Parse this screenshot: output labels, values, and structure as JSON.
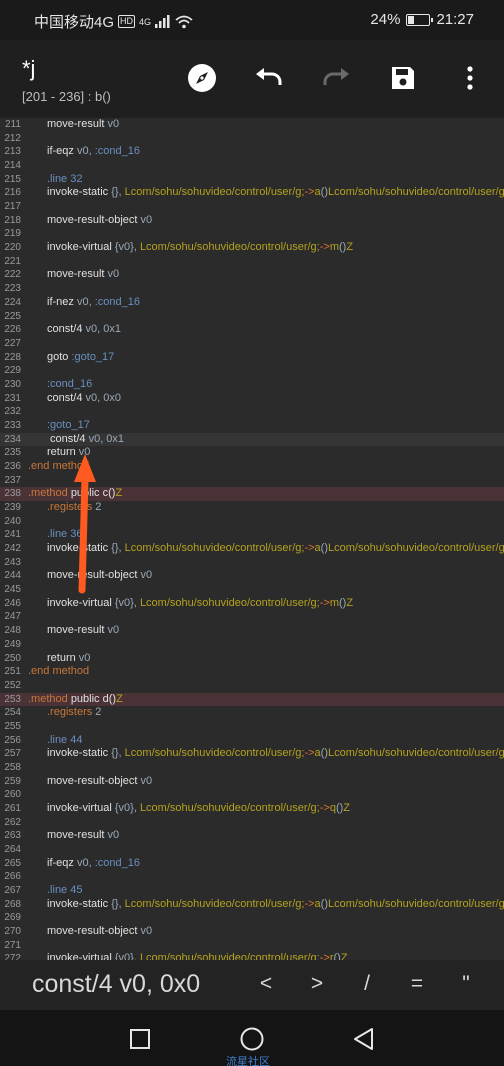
{
  "status": {
    "carrier": "中国移动4G",
    "hd": "HD",
    "signal_tag": "4G",
    "battery_percent": "24%",
    "battery_level": 0.24,
    "time": "21:27"
  },
  "toolbar": {
    "title": "*j",
    "subtitle": "[201 - 236] : b()",
    "icons": [
      "compass-icon",
      "undo-icon",
      "redo-icon",
      "save-icon",
      "more-vert-icon"
    ]
  },
  "code_lines": [
    {
      "n": "211",
      "segs": [
        [
          "kw",
          "move-result "
        ],
        [
          "reg",
          "v0"
        ]
      ]
    },
    {
      "n": "212",
      "segs": []
    },
    {
      "n": "213",
      "segs": [
        [
          "kw",
          "if-eqz "
        ],
        [
          "reg",
          "v0, "
        ],
        [
          "lbl",
          ":cond_16"
        ]
      ]
    },
    {
      "n": "214",
      "segs": []
    },
    {
      "n": "215",
      "segs": [
        [
          "lbl",
          ".line "
        ],
        [
          "lbl",
          "32"
        ]
      ]
    },
    {
      "n": "216",
      "segs": [
        [
          "kw",
          "invoke-static "
        ],
        [
          "reg",
          "{}, "
        ],
        [
          "cls",
          "Lcom/sohu/sohuvideo/control/user/g;"
        ],
        [
          "arrow",
          "->"
        ],
        [
          "cls",
          "a"
        ],
        [
          "reg",
          "()"
        ],
        [
          "cls",
          "Lcom/sohu/sohuvideo/control/user/g;"
        ]
      ]
    },
    {
      "n": "217",
      "segs": []
    },
    {
      "n": "218",
      "segs": [
        [
          "kw",
          "move-result-object "
        ],
        [
          "reg",
          "v0"
        ]
      ]
    },
    {
      "n": "219",
      "segs": []
    },
    {
      "n": "220",
      "segs": [
        [
          "kw",
          "invoke-virtual "
        ],
        [
          "reg",
          "{v0}, "
        ],
        [
          "cls",
          "Lcom/sohu/sohuvideo/control/user/g;"
        ],
        [
          "arrow",
          "->"
        ],
        [
          "cls",
          "m"
        ],
        [
          "reg",
          "()"
        ],
        [
          "cls",
          "Z"
        ]
      ]
    },
    {
      "n": "221",
      "segs": []
    },
    {
      "n": "222",
      "segs": [
        [
          "kw",
          "move-result "
        ],
        [
          "reg",
          "v0"
        ]
      ]
    },
    {
      "n": "223",
      "segs": []
    },
    {
      "n": "224",
      "segs": [
        [
          "kw",
          "if-nez "
        ],
        [
          "reg",
          "v0, "
        ],
        [
          "lbl",
          ":cond_16"
        ]
      ]
    },
    {
      "n": "225",
      "segs": []
    },
    {
      "n": "226",
      "segs": [
        [
          "kw",
          "const/4 "
        ],
        [
          "reg",
          "v0, 0x1"
        ]
      ]
    },
    {
      "n": "227",
      "segs": []
    },
    {
      "n": "228",
      "segs": [
        [
          "kw",
          "goto "
        ],
        [
          "lbl",
          ":goto_17"
        ]
      ]
    },
    {
      "n": "229",
      "segs": []
    },
    {
      "n": "230",
      "segs": [
        [
          "lbl",
          ":cond_16"
        ]
      ]
    },
    {
      "n": "231",
      "segs": [
        [
          "kw",
          "const/4 "
        ],
        [
          "reg",
          "v0, 0x0"
        ]
      ]
    },
    {
      "n": "232",
      "segs": []
    },
    {
      "n": "233",
      "segs": [
        [
          "lbl",
          ":goto_17"
        ]
      ]
    },
    {
      "n": "234",
      "segs": [
        [
          "kw",
          " const/4 "
        ],
        [
          "reg",
          "v0, 0x1"
        ]
      ],
      "hl": "current"
    },
    {
      "n": "235",
      "segs": [
        [
          "kw",
          "return "
        ],
        [
          "reg",
          "v0"
        ]
      ]
    },
    {
      "n": "236",
      "segs": [
        [
          "dir",
          ".end method"
        ]
      ],
      "indent": 0
    },
    {
      "n": "237",
      "segs": []
    },
    {
      "n": "238",
      "segs": [
        [
          "dir",
          ".method "
        ],
        [
          "kw",
          "public c()"
        ],
        [
          "cls",
          "Z"
        ]
      ],
      "indent": 0,
      "hl": "method"
    },
    {
      "n": "239",
      "segs": [
        [
          "dir",
          ".registers "
        ],
        [
          "reg",
          "2"
        ]
      ]
    },
    {
      "n": "240",
      "segs": []
    },
    {
      "n": "241",
      "segs": [
        [
          "lbl",
          ".line "
        ],
        [
          "lbl",
          "36"
        ]
      ]
    },
    {
      "n": "242",
      "segs": [
        [
          "kw",
          "invoke-static "
        ],
        [
          "reg",
          "{}, "
        ],
        [
          "cls",
          "Lcom/sohu/sohuvideo/control/user/g;"
        ],
        [
          "arrow",
          "->"
        ],
        [
          "cls",
          "a"
        ],
        [
          "reg",
          "()"
        ],
        [
          "cls",
          "Lcom/sohu/sohuvideo/control/user/g;"
        ]
      ]
    },
    {
      "n": "243",
      "segs": []
    },
    {
      "n": "244",
      "segs": [
        [
          "kw",
          "move-result-object "
        ],
        [
          "reg",
          "v0"
        ]
      ]
    },
    {
      "n": "245",
      "segs": []
    },
    {
      "n": "246",
      "segs": [
        [
          "kw",
          "invoke-virtual "
        ],
        [
          "reg",
          "{v0}, "
        ],
        [
          "cls",
          "Lcom/sohu/sohuvideo/control/user/g;"
        ],
        [
          "arrow",
          "->"
        ],
        [
          "cls",
          "m"
        ],
        [
          "reg",
          "()"
        ],
        [
          "cls",
          "Z"
        ]
      ]
    },
    {
      "n": "247",
      "segs": []
    },
    {
      "n": "248",
      "segs": [
        [
          "kw",
          "move-result "
        ],
        [
          "reg",
          "v0"
        ]
      ]
    },
    {
      "n": "249",
      "segs": []
    },
    {
      "n": "250",
      "segs": [
        [
          "kw",
          "return "
        ],
        [
          "reg",
          "v0"
        ]
      ]
    },
    {
      "n": "251",
      "segs": [
        [
          "dir",
          ".end method"
        ]
      ],
      "indent": 0
    },
    {
      "n": "252",
      "segs": []
    },
    {
      "n": "253",
      "segs": [
        [
          "dir",
          ".method "
        ],
        [
          "kw",
          "public d()"
        ],
        [
          "cls",
          "Z"
        ]
      ],
      "indent": 0,
      "hl": "method"
    },
    {
      "n": "254",
      "segs": [
        [
          "dir",
          ".registers "
        ],
        [
          "reg",
          "2"
        ]
      ]
    },
    {
      "n": "255",
      "segs": []
    },
    {
      "n": "256",
      "segs": [
        [
          "lbl",
          ".line "
        ],
        [
          "lbl",
          "44"
        ]
      ]
    },
    {
      "n": "257",
      "segs": [
        [
          "kw",
          "invoke-static "
        ],
        [
          "reg",
          "{}, "
        ],
        [
          "cls",
          "Lcom/sohu/sohuvideo/control/user/g;"
        ],
        [
          "arrow",
          "->"
        ],
        [
          "cls",
          "a"
        ],
        [
          "reg",
          "()"
        ],
        [
          "cls",
          "Lcom/sohu/sohuvideo/control/user/g;"
        ]
      ]
    },
    {
      "n": "258",
      "segs": []
    },
    {
      "n": "259",
      "segs": [
        [
          "kw",
          "move-result-object "
        ],
        [
          "reg",
          "v0"
        ]
      ]
    },
    {
      "n": "260",
      "segs": []
    },
    {
      "n": "261",
      "segs": [
        [
          "kw",
          "invoke-virtual "
        ],
        [
          "reg",
          "{v0}, "
        ],
        [
          "cls",
          "Lcom/sohu/sohuvideo/control/user/g;"
        ],
        [
          "arrow",
          "->"
        ],
        [
          "cls",
          "q"
        ],
        [
          "reg",
          "()"
        ],
        [
          "cls",
          "Z"
        ]
      ]
    },
    {
      "n": "262",
      "segs": []
    },
    {
      "n": "263",
      "segs": [
        [
          "kw",
          "move-result "
        ],
        [
          "reg",
          "v0"
        ]
      ]
    },
    {
      "n": "264",
      "segs": []
    },
    {
      "n": "265",
      "segs": [
        [
          "kw",
          "if-eqz "
        ],
        [
          "reg",
          "v0, "
        ],
        [
          "lbl",
          ":cond_16"
        ]
      ]
    },
    {
      "n": "266",
      "segs": []
    },
    {
      "n": "267",
      "segs": [
        [
          "lbl",
          ".line "
        ],
        [
          "lbl",
          "45"
        ]
      ]
    },
    {
      "n": "268",
      "segs": [
        [
          "kw",
          "invoke-static "
        ],
        [
          "reg",
          "{}, "
        ],
        [
          "cls",
          "Lcom/sohu/sohuvideo/control/user/g;"
        ],
        [
          "arrow",
          "->"
        ],
        [
          "cls",
          "a"
        ],
        [
          "reg",
          "()"
        ],
        [
          "cls",
          "Lcom/sohu/sohuvideo/control/user/g;"
        ]
      ]
    },
    {
      "n": "269",
      "segs": []
    },
    {
      "n": "270",
      "segs": [
        [
          "kw",
          "move-result-object "
        ],
        [
          "reg",
          "v0"
        ]
      ]
    },
    {
      "n": "271",
      "segs": []
    },
    {
      "n": "272",
      "segs": [
        [
          "kw",
          "invoke-virtual "
        ],
        [
          "reg",
          "{v0}, "
        ],
        [
          "cls",
          "Lcom/sohu/sohuvideo/control/user/g;"
        ],
        [
          "arrow",
          "->"
        ],
        [
          "cls",
          "r"
        ],
        [
          "reg",
          "()"
        ],
        [
          "cls",
          "Z"
        ]
      ]
    }
  ],
  "accessory": {
    "snippet": "const/4 v0, 0x0",
    "keys": [
      "<",
      ">",
      "/",
      "=",
      "\""
    ]
  },
  "nav": {
    "icons": [
      "recents-square-icon",
      "home-circle-icon",
      "back-triangle-icon"
    ],
    "watermark": "流星社区"
  },
  "colors": {
    "annotation_arrow": "#ff5a1f",
    "method_highlight": "#4a3236",
    "current_line": "#353535"
  }
}
